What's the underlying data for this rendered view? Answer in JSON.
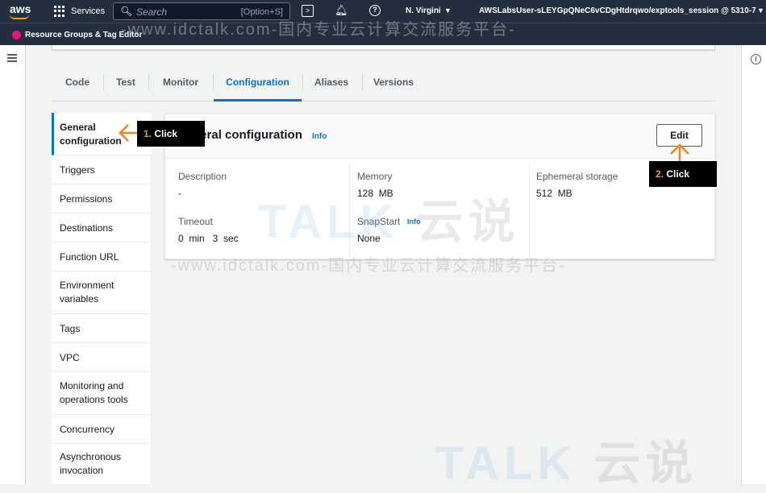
{
  "topbar": {
    "logo": "aws",
    "services_label": "Services",
    "search_placeholder": "Search",
    "search_shortcut": "[Option+S]",
    "region": "N. Virgini",
    "account": "AWSLabsUser-sLEYGpQNeC6vCDgHtdrqwo/exptools_session @ 5310-7"
  },
  "secondbar": {
    "service_label": "Resource Groups & Tag Editor"
  },
  "tabs": [
    {
      "label": "Code",
      "active": false
    },
    {
      "label": "Test",
      "active": false
    },
    {
      "label": "Monitor",
      "active": false
    },
    {
      "label": "Configuration",
      "active": true
    },
    {
      "label": "Aliases",
      "active": false
    },
    {
      "label": "Versions",
      "active": false
    }
  ],
  "sidenav": {
    "items": [
      {
        "label": "General configuration",
        "active": true
      },
      {
        "label": "Triggers"
      },
      {
        "label": "Permissions"
      },
      {
        "label": "Destinations"
      },
      {
        "label": "Function URL"
      },
      {
        "label": "Environment variables"
      },
      {
        "label": "Tags"
      },
      {
        "label": "VPC"
      },
      {
        "label": "Monitoring and operations tools"
      },
      {
        "label": "Concurrency"
      },
      {
        "label": "Asynchronous invocation"
      }
    ]
  },
  "card": {
    "title": "General configuration",
    "info": "Info",
    "edit_label": "Edit",
    "fields": {
      "description_label": "Description",
      "description_value": "-",
      "memory_label": "Memory",
      "memory_value": "128  MB",
      "ephemeral_label": "Ephemeral storage",
      "ephemeral_value": "512  MB",
      "timeout_label": "Timeout",
      "timeout_value": "0  min   3  sec",
      "snapstart_label": "SnapStart",
      "snapstart_info": "Info",
      "snapstart_value": "None"
    }
  },
  "annotations": {
    "step1_num": "1.",
    "step1_text": "Click",
    "step2_num": "2.",
    "step2_text": "Click",
    "arrow_color": "#f5821f"
  },
  "watermark": {
    "url_text": "-www.idctalk.com-国内专业云计算交流服务平台-",
    "logo_text": "TALK",
    "logo_cn": "云说"
  },
  "colors": {
    "accent": "#0972d3",
    "nav_dark": "#232f3e",
    "highlight": "#ff9900"
  }
}
